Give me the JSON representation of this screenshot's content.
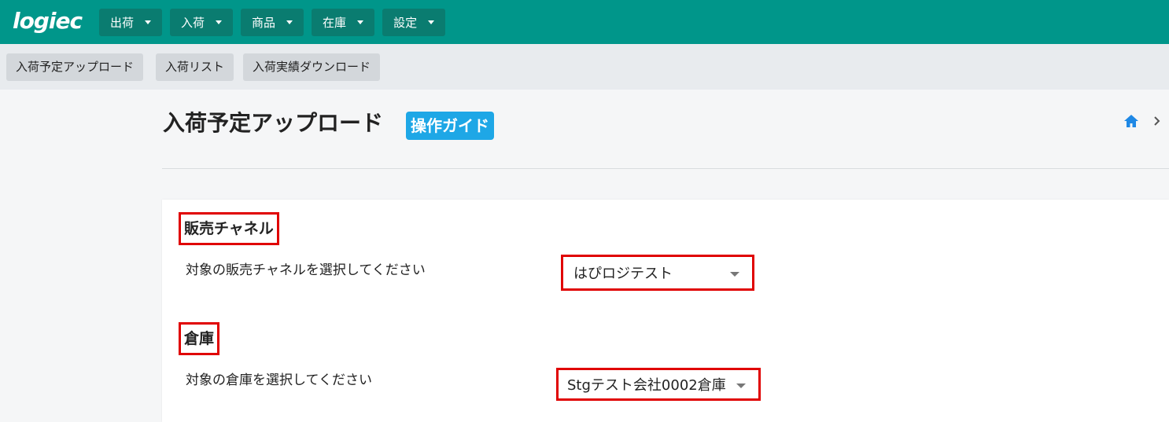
{
  "app": {
    "logo": "logiec"
  },
  "navbar": {
    "menus": [
      {
        "label": "出荷"
      },
      {
        "label": "入荷"
      },
      {
        "label": "商品"
      },
      {
        "label": "在庫"
      },
      {
        "label": "設定"
      }
    ]
  },
  "subnav": {
    "items": [
      {
        "label": "入荷予定アップロード"
      },
      {
        "label": "入荷リスト"
      },
      {
        "label": "入荷実績ダウンロード"
      }
    ]
  },
  "page": {
    "title": "入荷予定アップロード",
    "guide_label": "操作ガイド"
  },
  "form": {
    "channel": {
      "heading": "販売チャネル",
      "description": "対象の販売チャネルを選択してください",
      "selected": "はぴロジテスト"
    },
    "warehouse": {
      "heading": "倉庫",
      "description": "対象の倉庫を選択してください",
      "selected": "Stgテスト会社0002倉庫"
    }
  },
  "colors": {
    "navbar": "#00968a",
    "nav_button": "#0a7c70",
    "guide_badge": "#1ea7e6",
    "highlight": "#e00000",
    "home_icon": "#1e88e5"
  }
}
